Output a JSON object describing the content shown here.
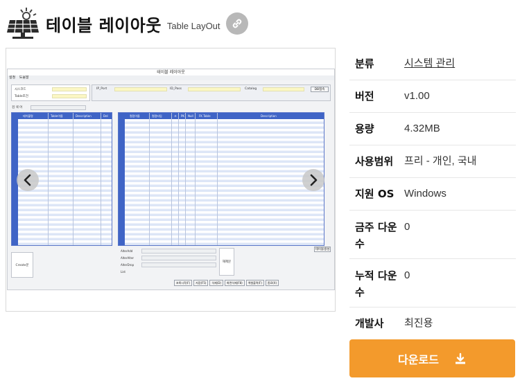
{
  "header": {
    "title": "테이블 레이아웃",
    "subtitle": "Table LayOut",
    "logo_icon": "solar-panel-icon",
    "link_icon": "link-icon"
  },
  "screenshot": {
    "window_title": "테이블 레이아웃",
    "menu": [
      "설정",
      "도움말"
    ],
    "left_box": {
      "label1": "시스코드",
      "label2": "Table조건"
    },
    "right_box": {
      "ip_label": "IP_Port",
      "id_label": "ID_Pass",
      "catalog_label": "Catalog",
      "connect_button": "DB접속"
    },
    "search_label": "검 색 어",
    "left_grid_headers": [
      "테이블명",
      "Table이름",
      "Description",
      "Del"
    ],
    "right_grid_headers": [
      "컬럼이름",
      "컬럼타입",
      "크",
      "PK",
      "Null",
      "FK Table",
      "Description"
    ],
    "right_side_button": "테이블생성",
    "bottom": {
      "create_label": "Create문",
      "alter_labels": [
        "AlterAdd",
        "AlterAlter",
        "AlterDrop",
        "List"
      ],
      "apply_label": "해제문"
    },
    "buttons": [
      "초록시작(F)",
      "저장(F5)",
      "삭제(D)",
      "화면삭제(F8)",
      "엑셀출력(F)",
      "종료(X)"
    ],
    "nav_prev_icon": "chevron-left-icon",
    "nav_next_icon": "chevron-right-icon"
  },
  "info": [
    {
      "key": "분류",
      "value": "시스템 관리",
      "link": true
    },
    {
      "key": "버전",
      "value": "v1.00"
    },
    {
      "key": "용량",
      "value": "4.32MB"
    },
    {
      "key": "사용범위",
      "value": "프리 - 개인, 국내"
    },
    {
      "key": "지원 OS",
      "value": "Windows"
    },
    {
      "key": "금주 다운수",
      "value": "0"
    },
    {
      "key": "누적 다운수",
      "value": "0"
    },
    {
      "key": "개발사",
      "value": "최진용"
    }
  ],
  "download": {
    "label": "다운로드",
    "icon": "download-icon"
  },
  "colors": {
    "accent": "#f39a2c",
    "grid_header": "#3f64c6"
  }
}
